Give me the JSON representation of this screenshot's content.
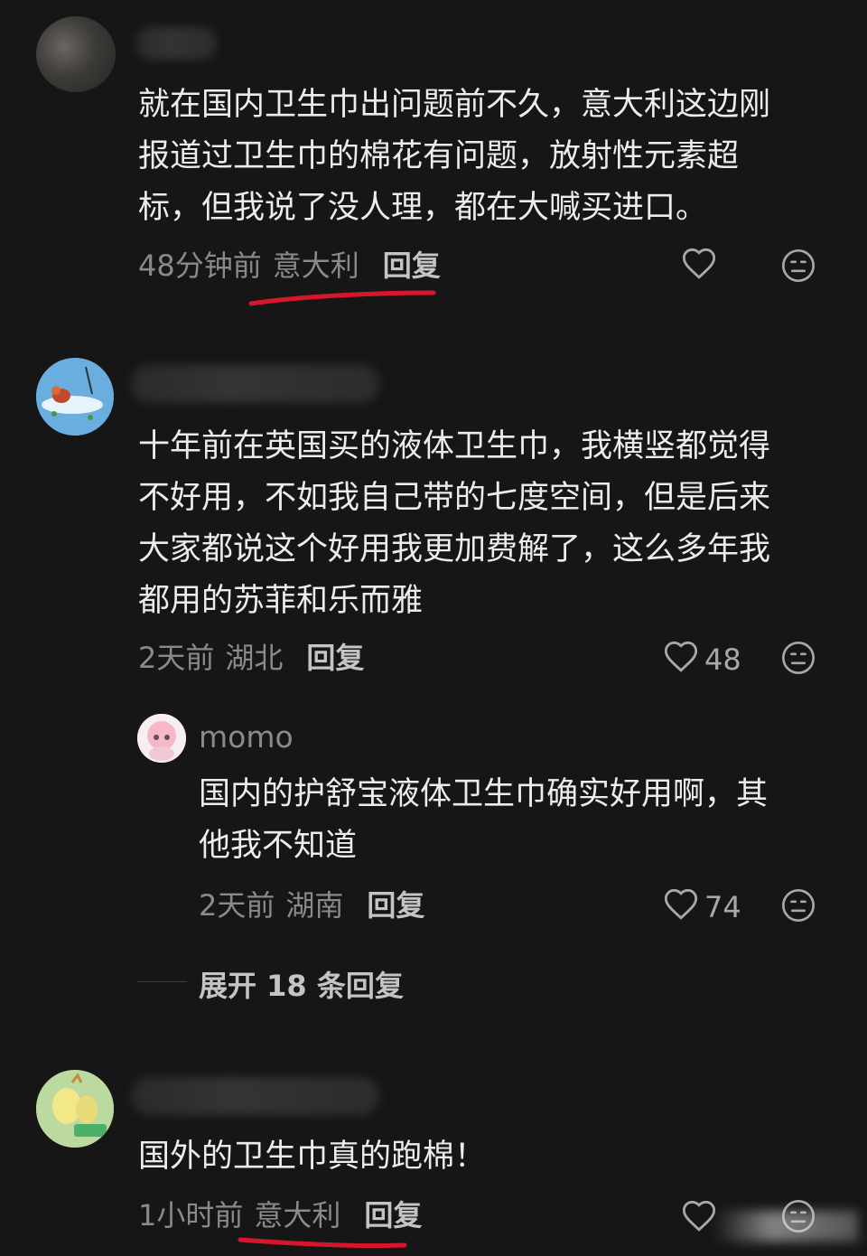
{
  "comments": [
    {
      "text_lines": [
        "就在国内卫生巾出问题前不久，意大利这边刚",
        "报道过卫生巾的棉花有问题，放射性元素超",
        "标，但我说了没人理，都在大喊买进口。"
      ],
      "time": "48分钟前",
      "location": "意大利",
      "reply_label": "回复",
      "likes": ""
    },
    {
      "text_lines": [
        "十年前在英国买的液体卫生巾，我横竖都觉得",
        "不好用，不如我自己带的七度空间，但是后来",
        "大家都说这个好用我更加费解了，这么多年我",
        "都用的苏菲和乐而雅"
      ],
      "time": "2天前",
      "location": "湖北",
      "reply_label": "回复",
      "likes": "48",
      "sub_reply": {
        "username": "momo",
        "text_lines": [
          "国内的护舒宝液体卫生巾确实好用啊，其",
          "他我不知道"
        ],
        "time": "2天前",
        "location": "湖南",
        "reply_label": "回复",
        "likes": "74"
      },
      "expand_label": "展开 18 条回复"
    },
    {
      "text_lines": [
        "国外的卫生巾真的跑棉！"
      ],
      "time": "1小时前",
      "location": "意大利",
      "reply_label": "回复",
      "likes": ""
    }
  ],
  "icons": {
    "like": "heart-outline-icon",
    "dislike": "neutral-face-icon"
  },
  "colors": {
    "background": "#161617",
    "text": "#ececec",
    "meta": "#8a8a8c",
    "annotation": "#d8162b"
  }
}
